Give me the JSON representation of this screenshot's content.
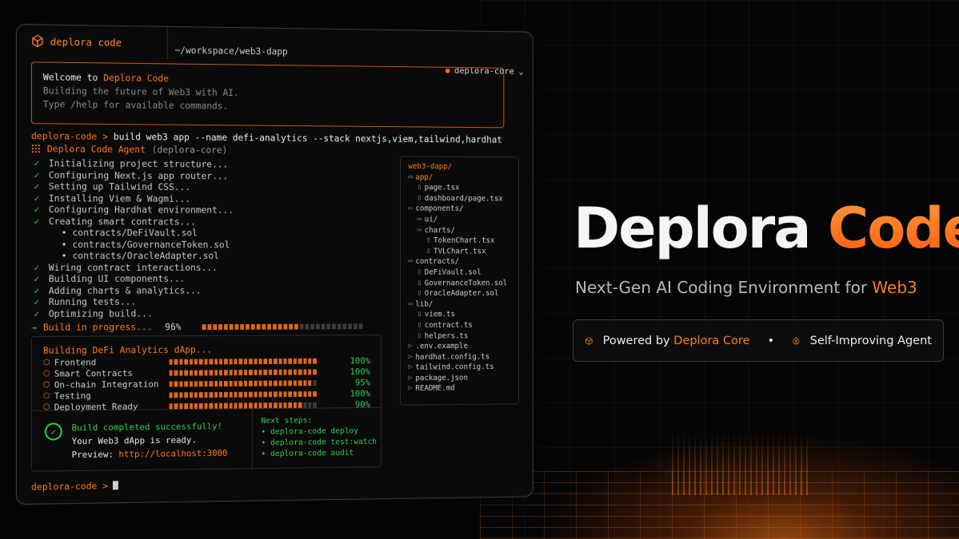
{
  "titlebar": {
    "brand": "deplora code",
    "path": "~/workspace/web3-dapp",
    "status": "deplora-core",
    "status_chevron": "⌄"
  },
  "welcome": {
    "prefix": "Welcome to ",
    "brand": "Deplora Code",
    "line2": "Building the future of Web3 with AI.",
    "line3": "Type /help for available commands."
  },
  "command": {
    "prompt": "deplora-code >",
    "text": "build web3 app --name defi-analytics --stack nextjs,viem,tailwind,hardhat"
  },
  "agent": {
    "name": "Deplora Code Agent",
    "sub": "(deplora-core)"
  },
  "steps": [
    {
      "type": "check",
      "text": "Initializing project structure..."
    },
    {
      "type": "check",
      "text": "Configuring Next.js app router..."
    },
    {
      "type": "check",
      "text": "Setting up Tailwind CSS..."
    },
    {
      "type": "check",
      "text": "Installing Viem & Wagmi..."
    },
    {
      "type": "check",
      "text": "Configuring Hardhat environment..."
    },
    {
      "type": "check",
      "text": "Creating smart contracts..."
    },
    {
      "type": "sub",
      "text": "• contracts/DeFiVault.sol"
    },
    {
      "type": "sub",
      "text": "• contracts/GovernanceToken.sol"
    },
    {
      "type": "sub",
      "text": "• contracts/OracleAdapter.sol"
    },
    {
      "type": "check",
      "text": "Wiring contract interactions..."
    },
    {
      "type": "check",
      "text": "Building UI components..."
    },
    {
      "type": "check",
      "text": "Adding charts & analytics..."
    },
    {
      "type": "check",
      "text": "Running tests..."
    },
    {
      "type": "check",
      "text": "Optimizing build..."
    }
  ],
  "progress": {
    "arrow": "→",
    "label": "Build in progress...",
    "percent_text": "96%",
    "fraction": 0.6
  },
  "tree": {
    "root": "web3-dapp/",
    "items": [
      {
        "depth": 0,
        "kind": "folder-open",
        "name": "app/"
      },
      {
        "depth": 1,
        "kind": "file",
        "name": "page.tsx"
      },
      {
        "depth": 1,
        "kind": "file",
        "name": "dashboard/page.tsx"
      },
      {
        "depth": 0,
        "kind": "folder",
        "name": "components/"
      },
      {
        "depth": 1,
        "kind": "folder",
        "name": "ui/"
      },
      {
        "depth": 1,
        "kind": "folder",
        "name": "charts/"
      },
      {
        "depth": 2,
        "kind": "file",
        "name": "TokenChart.tsx"
      },
      {
        "depth": 2,
        "kind": "file",
        "name": "TVLChart.tsx"
      },
      {
        "depth": 0,
        "kind": "folder",
        "name": "contracts/"
      },
      {
        "depth": 1,
        "kind": "file",
        "name": "DeFiVault.sol"
      },
      {
        "depth": 1,
        "kind": "file",
        "name": "GovernanceToken.sol"
      },
      {
        "depth": 1,
        "kind": "file",
        "name": "OracleAdapter.sol"
      },
      {
        "depth": 0,
        "kind": "folder",
        "name": "lib/"
      },
      {
        "depth": 1,
        "kind": "file",
        "name": "viem.ts"
      },
      {
        "depth": 1,
        "kind": "file",
        "name": "contract.ts"
      },
      {
        "depth": 1,
        "kind": "file",
        "name": "helpers.ts"
      },
      {
        "depth": 0,
        "kind": "arrow",
        "name": ".env.example"
      },
      {
        "depth": 0,
        "kind": "arrow",
        "name": "hardhat.config.ts"
      },
      {
        "depth": 0,
        "kind": "arrow",
        "name": "tailwind.config.ts"
      },
      {
        "depth": 0,
        "kind": "arrow",
        "name": "package.json"
      },
      {
        "depth": 0,
        "kind": "arrow",
        "name": "README.md"
      }
    ]
  },
  "build": {
    "title": "Building DeFi Analytics dApp...",
    "rows": [
      {
        "label": "Frontend",
        "pct": "100%",
        "fraction": 1.0
      },
      {
        "label": "Smart Contracts",
        "pct": "100%",
        "fraction": 1.0
      },
      {
        "label": "On-chain Integration",
        "pct": "95%",
        "fraction": 0.95
      },
      {
        "label": "Testing",
        "pct": "100%",
        "fraction": 1.0
      },
      {
        "label": "Deployment Ready",
        "pct": "90%",
        "fraction": 0.9
      }
    ],
    "success_title": "Build completed successfully!",
    "success_line": "Your Web3 dApp is ready.",
    "preview_label": "Preview:",
    "preview_url": "http://localhost:3000",
    "next_title": "Next steps:",
    "next_steps": [
      "• deplora-code deploy",
      "• deplora-code test:watch",
      "• deplora-code audit"
    ]
  },
  "bottom_prompt": "deplora-code >",
  "hero": {
    "title_white": "Deplora ",
    "title_orange": "Code",
    "subtitle_prefix": "Next-Gen AI Coding Environment for ",
    "subtitle_accent": "Web3",
    "pill_left_prefix": "Powered by ",
    "pill_left_accent": "Deplora Core",
    "bullet": "•",
    "pill_right": "Self-Improving Agent"
  },
  "colors": {
    "accent": "#ff7a1f",
    "success": "#35d04a",
    "background": "#050505"
  }
}
